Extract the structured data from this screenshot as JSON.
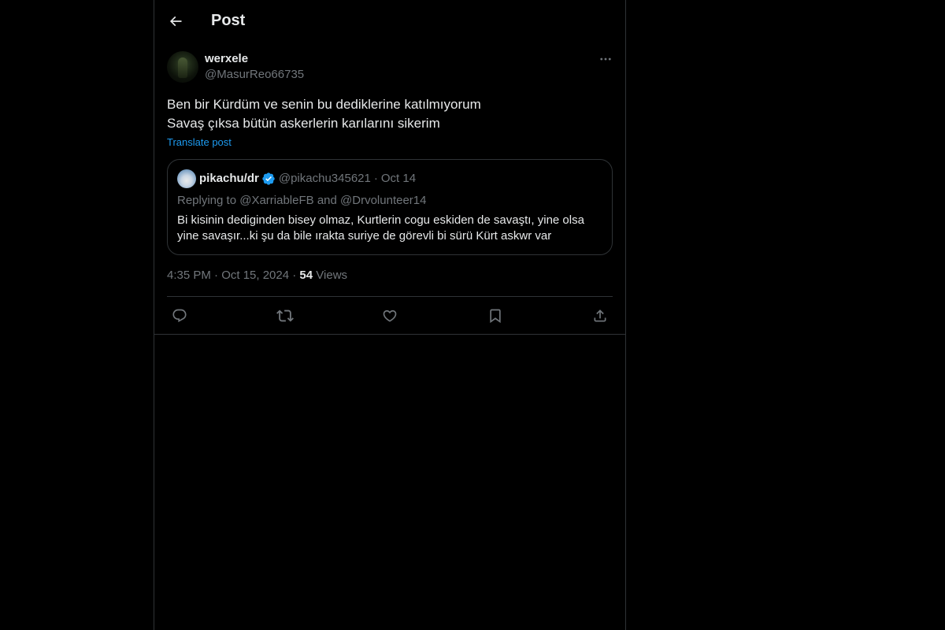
{
  "header": {
    "title": "Post"
  },
  "post": {
    "author_name": "werxele",
    "author_handle": "@MasurReo66735",
    "text_line1": "Ben bir Kürdüm ve senin bu dediklerine katılmıyorum",
    "text_line2": "Savaş çıksa bütün askerlerin karılarını sikerim",
    "translate_label": "Translate post",
    "timestamp": "4:35 PM · Oct 15, 2024 · ",
    "views_count": "54",
    "views_label": "Views"
  },
  "quote": {
    "author_name": "pikachu/dr",
    "author_handle": "@pikachu345621",
    "date": "Oct 14",
    "separator": "·",
    "replying_prefix": "Replying to ",
    "reply_user1": "@XarriableFB",
    "reply_and": " and ",
    "reply_user2": "@Drvolunteer14",
    "body_line1": "Bi kisinin dediginden bisey olmaz, Kurtlerin cogu eskiden de savaştı, yine olsa",
    "body_line2": "yine savaşır...ki şu da bile ırakta suriye de görevli bi sürü Kürt askwr var"
  },
  "icons": {
    "back": "arrow-left-icon",
    "more": "more-horizontal-icon",
    "verified": "verified-badge-icon",
    "reply": "reply-icon",
    "retweet": "retweet-icon",
    "like": "heart-icon",
    "bookmark": "bookmark-icon",
    "share": "share-icon"
  },
  "colors": {
    "background": "#000000",
    "border": "#2f3336",
    "text_primary": "#e7e9ea",
    "text_secondary": "#71767b",
    "accent": "#1d9bf0"
  }
}
